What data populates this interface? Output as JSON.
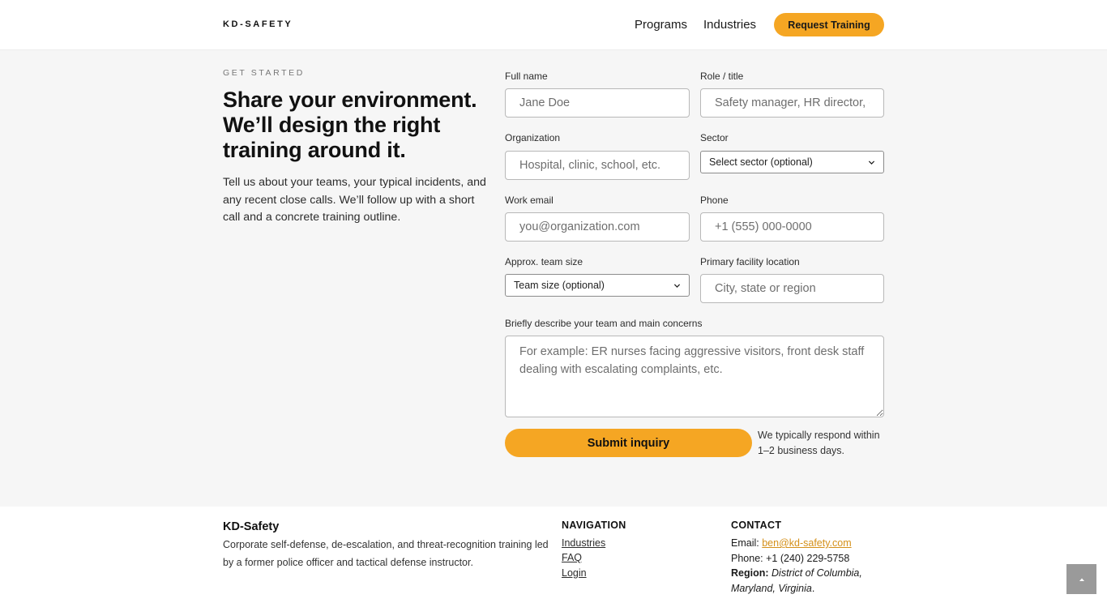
{
  "header": {
    "logo": "KD-SAFETY",
    "nav": [
      "Programs",
      "Industries"
    ],
    "cta_label": "Request Training"
  },
  "intro": {
    "eyebrow": "GET STARTED",
    "headline_lines": [
      "Share your environment.",
      "We’ll design the right",
      "training around it."
    ],
    "lede": "Tell us about your teams, your typical incidents, and any recent close calls. We’ll follow up with a short call and a concrete training outline."
  },
  "form": {
    "full_name": {
      "label": "Full name",
      "placeholder": "Jane Doe"
    },
    "role": {
      "label": "Role / title",
      "placeholder": "Safety manager, HR director, etc."
    },
    "organization": {
      "label": "Organization",
      "placeholder": "Hospital, clinic, school, etc."
    },
    "sector": {
      "label": "Sector",
      "selected": "Select sector (optional)"
    },
    "email": {
      "label": "Work email",
      "placeholder": "you@organization.com"
    },
    "phone": {
      "label": "Phone",
      "placeholder": "+1 (555) 000-0000"
    },
    "team_size": {
      "label": "Approx. team size",
      "selected": "Team size (optional)"
    },
    "location": {
      "label": "Primary facility location",
      "placeholder": "City, state or region"
    },
    "concerns": {
      "label": "Briefly describe your team and main concerns",
      "placeholder": "For example: ER nurses facing aggressive visitors, front desk staff dealing with escalating complaints, etc."
    },
    "submit_label": "Submit inquiry",
    "response_note": "We typically respond within 1–2 business days."
  },
  "footer": {
    "brand": "KD-Safety",
    "description": "Corporate self-defense, de-escalation, and threat-recognition training led by a former police officer and tactical defense instructor.",
    "nav_heading": "NAVIGATION",
    "nav_links": [
      "Industries",
      "FAQ",
      "Login"
    ],
    "contact_heading": "CONTACT",
    "email_label": "Email:",
    "email": "ben@kd-safety.com",
    "phone_label": "Phone:",
    "phone": "+1 (240) 229-5758",
    "region_label": "Region:",
    "region": "District of Columbia, Maryland, Virginia",
    "region_end": "."
  },
  "colors": {
    "accent": "#f5a623",
    "link": "#d4901a",
    "footer_bg": "#ffffff",
    "page_bg": "#f6f6f6"
  },
  "icons": {
    "select_arrow": "chevron-down-icon",
    "back_to_top": "chevron-up-icon"
  }
}
